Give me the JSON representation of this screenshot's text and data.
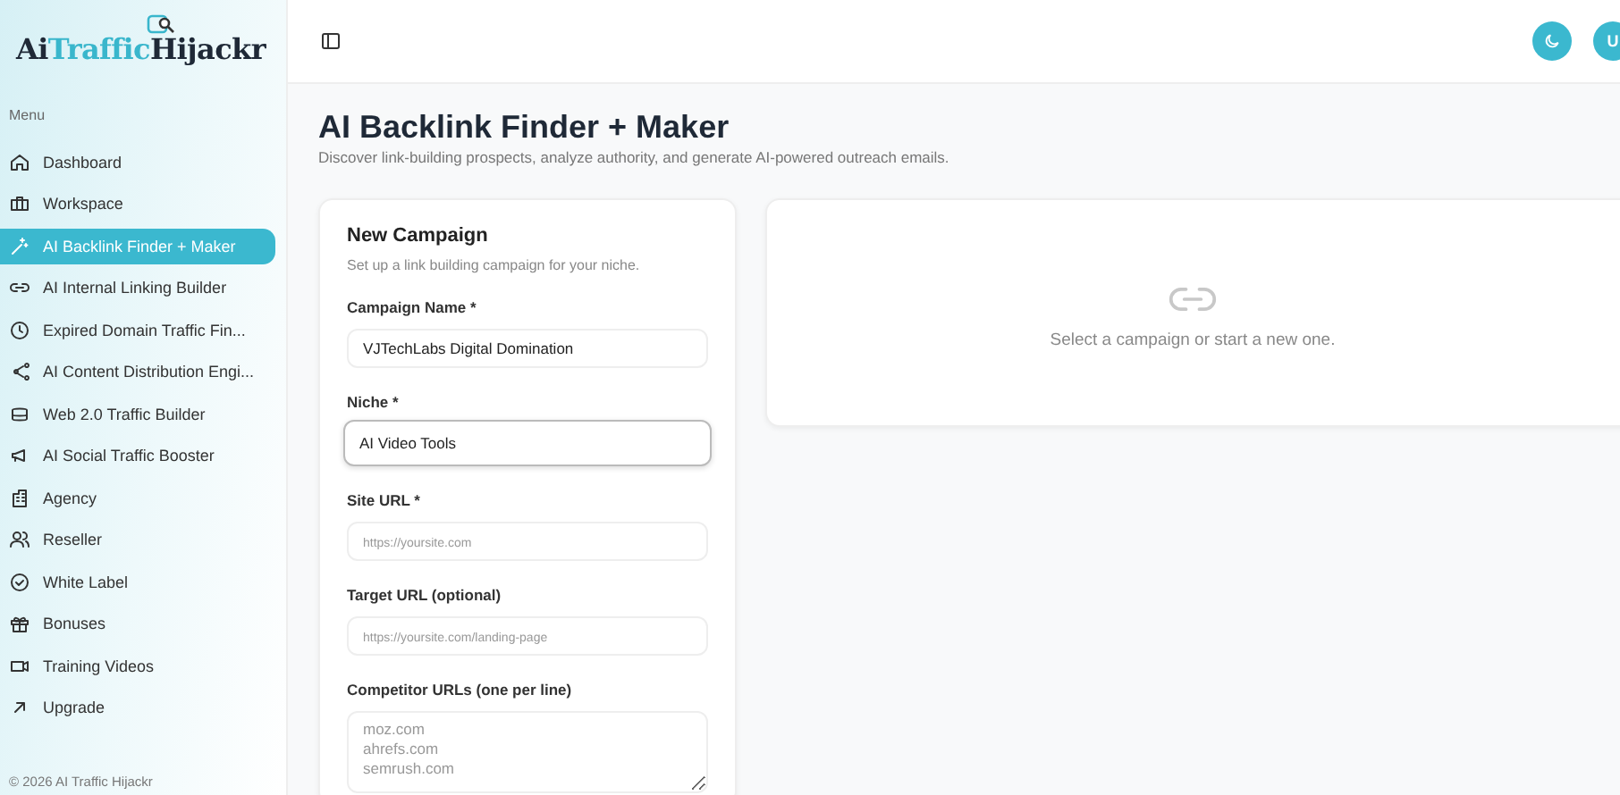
{
  "logo": {
    "first": "Ai",
    "accent": "Traffic",
    "last": "Hijackr"
  },
  "sidebar": {
    "heading": "Menu",
    "items": [
      {
        "label": "Dashboard",
        "selected": false
      },
      {
        "label": "Workspace",
        "selected": false
      },
      {
        "label": "AI Backlink Finder + Maker",
        "selected": true
      },
      {
        "label": "AI Internal Linking Builder",
        "selected": false
      },
      {
        "label": "Expired Domain Traffic Fin...",
        "selected": false
      },
      {
        "label": "AI Content Distribution Engi...",
        "selected": false
      },
      {
        "label": "Web 2.0 Traffic Builder",
        "selected": false
      },
      {
        "label": "AI Social Traffic Booster",
        "selected": false
      },
      {
        "label": "Agency",
        "selected": false
      },
      {
        "label": "Reseller",
        "selected": false
      },
      {
        "label": "White Label",
        "selected": false
      },
      {
        "label": "Bonuses",
        "selected": false
      },
      {
        "label": "Training Videos",
        "selected": false
      },
      {
        "label": "Upgrade",
        "selected": false
      }
    ],
    "footer": "© 2026 AI Traffic Hijackr"
  },
  "topbar": {
    "avatar": "U"
  },
  "page": {
    "title": "AI Backlink Finder + Maker",
    "subtitle": "Discover link-building prospects, analyze authority, and generate AI-powered outreach emails."
  },
  "form": {
    "title": "New Campaign",
    "subtitle": "Set up a link building campaign for your niche.",
    "fields": [
      {
        "label": "Campaign Name *",
        "value": "VJTechLabs Digital Domination",
        "focused": false
      },
      {
        "label": "Niche *",
        "value": "AI Video Tools",
        "focused": true
      },
      {
        "label": "Site URL *",
        "placeholder": "https://yoursite.com",
        "focused": false
      },
      {
        "label": "Target URL (optional)",
        "placeholder": "https://yoursite.com/landing-page",
        "focused": false
      }
    ],
    "textarea": {
      "label": "Competitor URLs (one per line)",
      "placeholder": "moz.com\nahrefs.com\nsemrush.com"
    }
  },
  "empty": {
    "message": "Select a campaign or start a new one."
  }
}
